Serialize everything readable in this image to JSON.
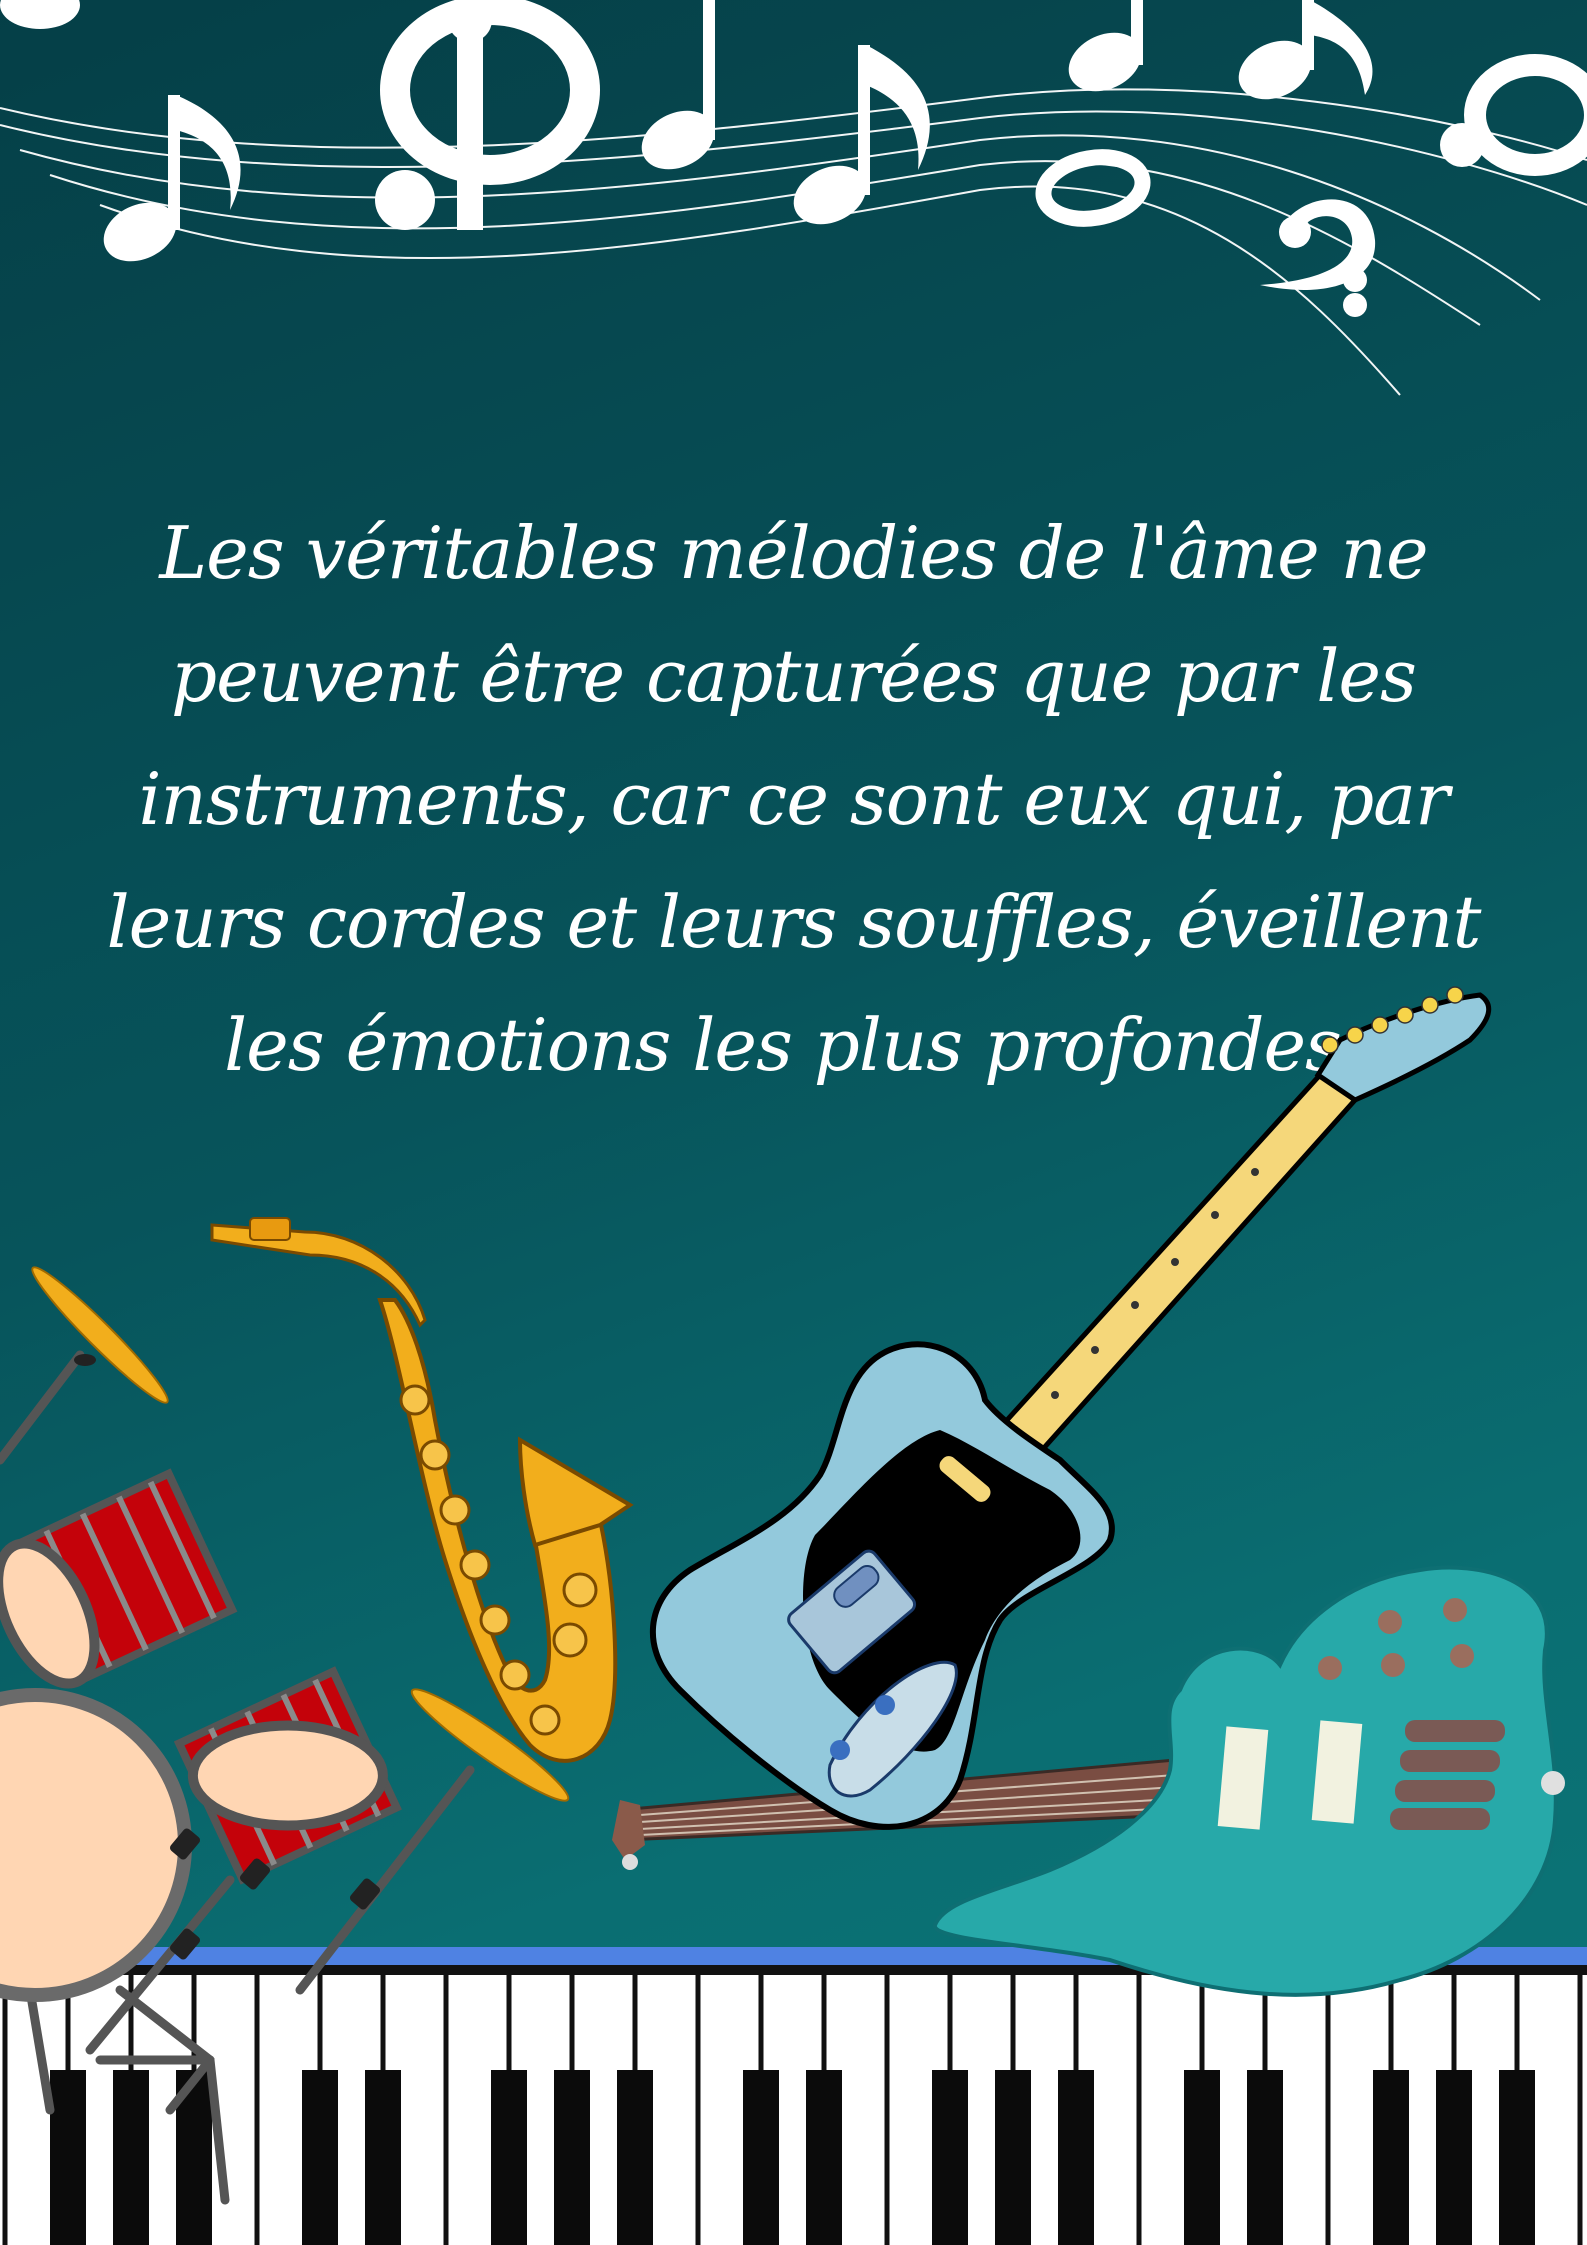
{
  "poster": {
    "quote_lines": [
      "Les véritables mélodies de l'âme ne",
      "peuvent être capturées que par les",
      "instruments, car ce sont eux qui, par",
      "leurs cordes et leurs souffles, éveillent",
      "les émotions les plus profondes."
    ]
  },
  "decorations": {
    "top": [
      "music-staff-icon",
      "treble-clef-icon",
      "bass-clef-icon",
      "music-note-icon"
    ],
    "bottom": [
      "drum-kit-icon",
      "saxophone-icon",
      "electric-guitar-icon",
      "bass-guitar-icon",
      "piano-keyboard-icon"
    ]
  },
  "colors": {
    "background_top": "#053f47",
    "background_bottom": "#0c7678",
    "text": "#ffffff",
    "sax": "#f2ae1c",
    "drum_red": "#c4020a",
    "guitar_body": "#93c9dc",
    "bass_body": "#27a9a9",
    "keyboard_frame": "#4f82e3"
  }
}
